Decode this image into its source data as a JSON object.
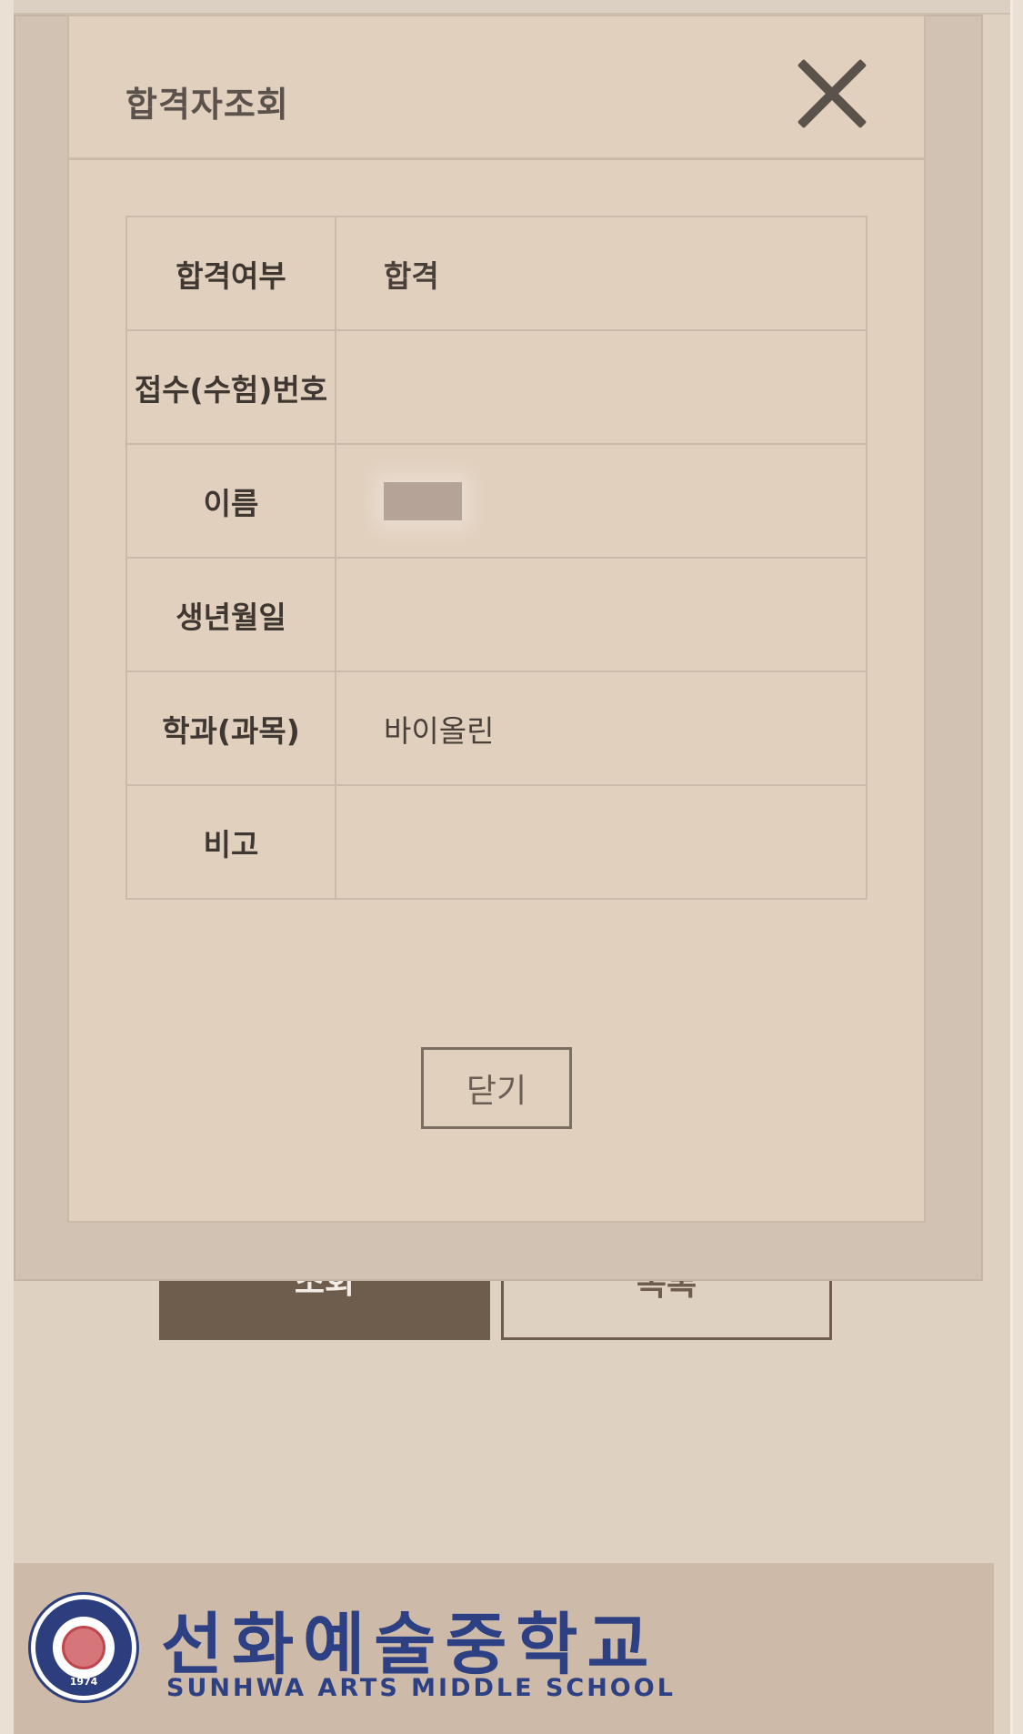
{
  "background": {
    "search_button_label": "조회",
    "list_button_label": "목록"
  },
  "modal": {
    "title": "합격자조회",
    "close_icon": "close-icon",
    "rows": [
      {
        "label": "합격여부",
        "value": "합격"
      },
      {
        "label": "접수(수험)번호",
        "value": ""
      },
      {
        "label": "이름",
        "value": ""
      },
      {
        "label": "생년월일",
        "value": ""
      },
      {
        "label": "학과(과목)",
        "value": "바이올린"
      },
      {
        "label": "비고",
        "value": ""
      }
    ],
    "close_button_label": "닫기"
  },
  "footer": {
    "school_name_ko": "선화예술중학교",
    "school_name_en": "SUNHWA ARTS MIDDLE SCHOOL",
    "emblem_year": "1974"
  },
  "colors": {
    "background": "#ded1c1",
    "pass_text": "#2f6b88",
    "brand_blue": "#2c4083",
    "dark_button": "#6e5c4d"
  }
}
